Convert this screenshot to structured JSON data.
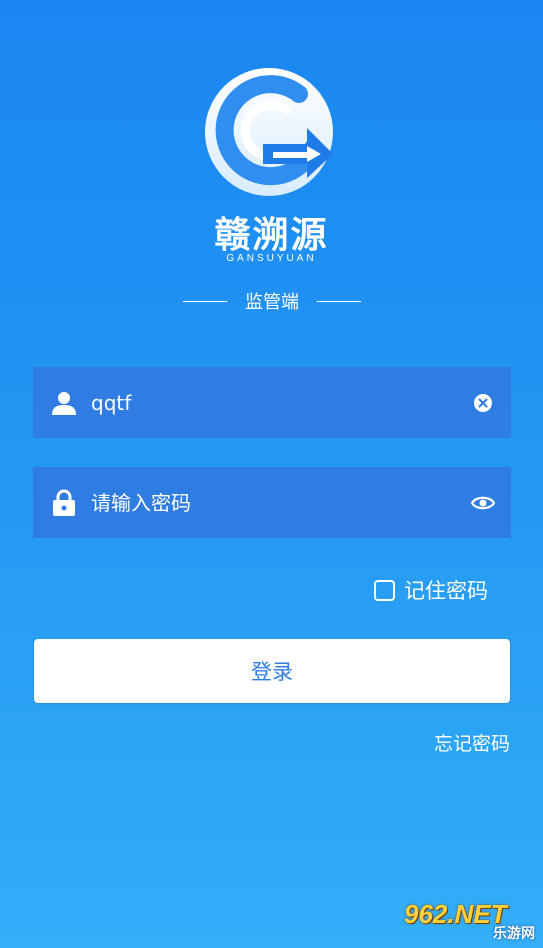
{
  "app": {
    "brand_name": "赣溯源",
    "brand_pinyin": "GANSUYUAN",
    "subtitle": "监管端"
  },
  "login": {
    "username_value": "qqtf",
    "password_placeholder": "请输入密码",
    "remember_label": "记住密码",
    "remember_checked": false,
    "submit_label": "登录",
    "forgot_label": "忘记密码"
  },
  "icons": {
    "logo": "g-arrow-logo",
    "user": "user-icon",
    "lock": "lock-icon",
    "clear": "clear-icon",
    "eye": "eye-icon"
  },
  "colors": {
    "background_top": "#1a86f2",
    "background_bottom": "#33aef7",
    "field_bg": "#2f7de3",
    "button_bg": "#ffffff",
    "button_text": "#2f7de3"
  },
  "watermark": {
    "main": "962.NET",
    "sub": "乐游网"
  }
}
